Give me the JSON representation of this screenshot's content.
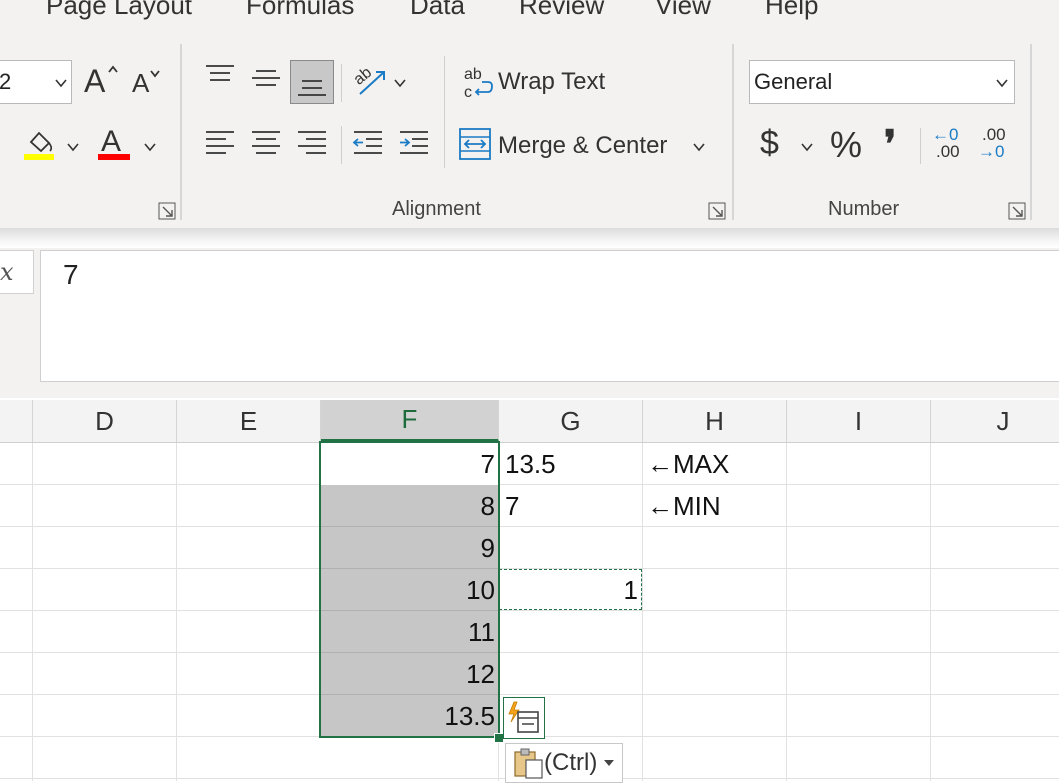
{
  "ribbon": {
    "tabs": [
      "Page Layout",
      "Formulas",
      "Data",
      "Review",
      "View",
      "Help"
    ],
    "font_size_value": "2",
    "alignment": {
      "group_label": "Alignment",
      "wrap_text_label": "Wrap Text",
      "merge_center_label": "Merge & Center"
    },
    "number": {
      "group_label": "Number",
      "format_value": "General",
      "currency_symbol": "$",
      "percent_symbol": "%",
      "comma_symbol": "❜",
      "increase_decimal_top": "←0",
      "increase_decimal_bottom": ".00",
      "decrease_decimal_top": ".00",
      "decrease_decimal_bottom": "→0"
    },
    "colors": {
      "fill_color": "#ffff00",
      "font_color": "#ff0000",
      "accent": "#217346",
      "arrow_blue": "#1b7bc4"
    }
  },
  "formula_bar": {
    "fx_label": "x",
    "value": "7"
  },
  "columns": [
    "D",
    "E",
    "F",
    "G",
    "H",
    "I",
    "J"
  ],
  "cells": {
    "F": [
      "7",
      "8",
      "9",
      "10",
      "11",
      "12",
      "13.5"
    ],
    "G1": "13.5",
    "G2": "7",
    "G4": "1",
    "H1": "←MAX",
    "H2": "←MIN"
  },
  "paste_options": {
    "label": "(Ctrl)"
  },
  "icons": [
    "font-grow-icon",
    "font-shrink-icon",
    "fill-color-icon",
    "font-color-icon",
    "align-top-icon",
    "align-middle-icon",
    "align-bottom-icon",
    "orientation-icon",
    "align-left-icon",
    "align-center-icon",
    "align-right-icon",
    "decrease-indent-icon",
    "increase-indent-icon",
    "wrap-text-icon",
    "merge-center-icon",
    "dialog-launcher-icon",
    "quick-analysis-icon",
    "paste-icon"
  ]
}
